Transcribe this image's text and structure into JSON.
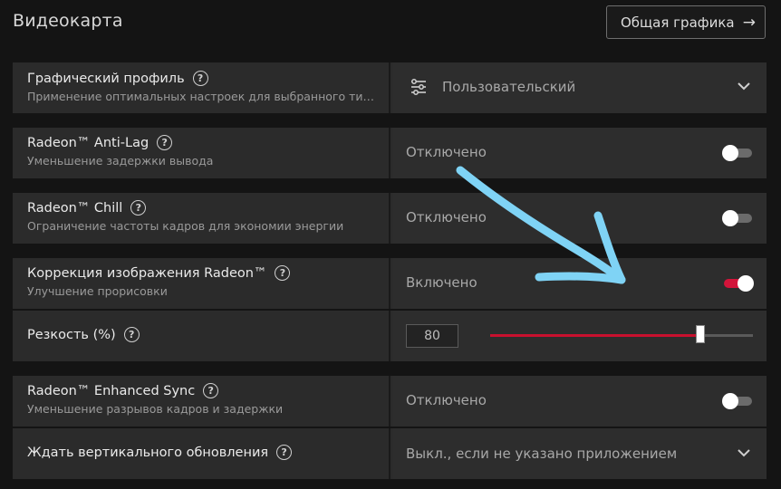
{
  "header": {
    "title": "Видеокарта",
    "overview_button": "Общая графика"
  },
  "rows": {
    "profile": {
      "title": "Графический профиль",
      "subtitle": "Применение оптимальных настроек для выбранного типа...",
      "value": "Пользовательский"
    },
    "antilag": {
      "title": "Radeon™ Anti-Lag",
      "subtitle": "Уменьшение задержки вывода",
      "value": "Отключено",
      "enabled": false
    },
    "chill": {
      "title": "Radeon™ Chill",
      "subtitle": "Ограничение частоты кадров для экономии энергии",
      "value": "Отключено",
      "enabled": false
    },
    "sharpening": {
      "title": "Коррекция изображения Radeon™",
      "subtitle": "Улучшение прорисовки",
      "value": "Включено",
      "enabled": true
    },
    "sharpness": {
      "title": "Резкость (%)",
      "value": "80",
      "percent": 80
    },
    "enhanced_sync": {
      "title": "Radeon™ Enhanced Sync",
      "subtitle": "Уменьшение разрывов кадров и задержки",
      "value": "Отключено",
      "enabled": false
    },
    "vsync": {
      "title": "Ждать вертикального обновления",
      "value": "Выкл., если не указано приложением"
    }
  },
  "colors": {
    "accent": "#d2143a",
    "annotation_arrow": "#7fd3f5"
  }
}
